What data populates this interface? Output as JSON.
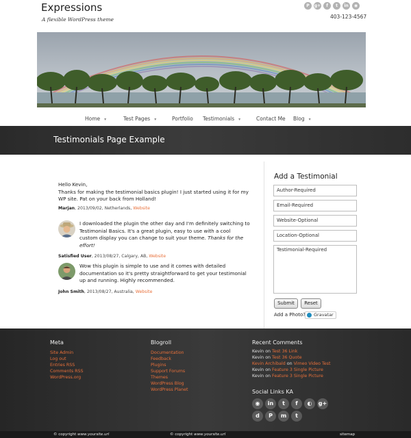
{
  "header": {
    "site_title": "Expressions",
    "tagline": "A flexible WordPress theme",
    "phone": "403-123-4567",
    "social_icons": [
      "pinterest-icon",
      "google-plus-icon",
      "facebook-icon",
      "twitter-icon",
      "linkedin-icon",
      "rss-icon"
    ]
  },
  "nav": {
    "items": [
      {
        "label": "Home",
        "has_submenu": true
      },
      {
        "label": "Test Pages",
        "has_submenu": true
      },
      {
        "label": "Portfolio",
        "has_submenu": false
      },
      {
        "label": "Testimonials",
        "has_submenu": true
      },
      {
        "label": "Contact Me",
        "has_submenu": false
      },
      {
        "label": "Blog",
        "has_submenu": true
      }
    ]
  },
  "page": {
    "title": "Testimonials Page Example"
  },
  "testimonials": [
    {
      "text_lines": [
        "Hello Kevin,",
        "Thanks for making the testimonial basics plugin! I just started using it for my WP site. Pat on your back from Holland!"
      ],
      "author": "Marjan",
      "details": ", 2013/09/02, Netherlands, ",
      "website_label": "Website"
    },
    {
      "text": "I downloaded the plugin the other day and I'm definitely switching to Testimonial Basics. It's a great plugin, easy to use with a cool custom display you can change to suit your theme. ",
      "text_italic": "Thanks for the effort!",
      "author": "Satisfied User",
      "details": ", 2013/08/27, Calgary, AB, ",
      "website_label": "Website"
    },
    {
      "text": "Wow this plugin is simple to use and it comes with detailed documentation so it's pretty straightforward to get your testimonial up and running. Highly recommended.",
      "author": "John Smith",
      "details": ", 2013/08/27, Australia, ",
      "website_label": "Website"
    }
  ],
  "form": {
    "title": "Add a Testimonial",
    "author_placeholder": "Author-Required",
    "email_placeholder": "Email-Required",
    "website_placeholder": "Website-Optional",
    "location_placeholder": "Location-Optional",
    "testimonial_placeholder": "Testimonial-Required",
    "submit_label": "Submit",
    "reset_label": "Reset",
    "photo_label": "Add a Photo?",
    "gravatar_label": "Gravatar"
  },
  "footer": {
    "meta": {
      "title": "Meta",
      "links": [
        "Site Admin",
        "Log out",
        "Entries RSS",
        "Comments RSS",
        "WordPress.org"
      ]
    },
    "blogroll": {
      "title": "Blogroll",
      "links": [
        "Documentation",
        "Feedback",
        "Plugins",
        "Support Forums",
        "Themes",
        "WordPress Blog",
        "WordPress Planet"
      ]
    },
    "recent_comments": {
      "title": "Recent Comments",
      "on_word": "on",
      "items": [
        {
          "who": "Kevin",
          "what": "Test 36 Link"
        },
        {
          "who": "Kevin",
          "what": "Test 36 Quote"
        },
        {
          "who": "Kevin Archibald",
          "what": "Vimeo Video Test"
        },
        {
          "who": "Kevin",
          "what": "Feature 3 Single Picture"
        },
        {
          "who": "Kevin",
          "what": "Feature 3 Single Picture"
        }
      ]
    },
    "social": {
      "title": "Social Links KA",
      "icons": [
        {
          "name": "rss-icon",
          "glyph": "◉"
        },
        {
          "name": "linkedin-icon",
          "glyph": "in"
        },
        {
          "name": "twitter-icon",
          "glyph": "t"
        },
        {
          "name": "facebook-icon",
          "glyph": "f"
        },
        {
          "name": "picasa-icon",
          "glyph": "◐"
        },
        {
          "name": "google-plus-icon",
          "glyph": "g+"
        },
        {
          "name": "digg-icon",
          "glyph": "d"
        },
        {
          "name": "pinterest-icon",
          "glyph": "P"
        },
        {
          "name": "myspace-icon",
          "glyph": "m"
        },
        {
          "name": "tumblr-icon",
          "glyph": "t"
        }
      ]
    },
    "copyright_prefix": "© copyright ",
    "copyright_site": "www.yoursite.url",
    "sitemap_label": "sitemap"
  },
  "colors": {
    "accent": "#e8703a",
    "footer_bg": "#333333",
    "title_bar_bg": "#333333"
  }
}
